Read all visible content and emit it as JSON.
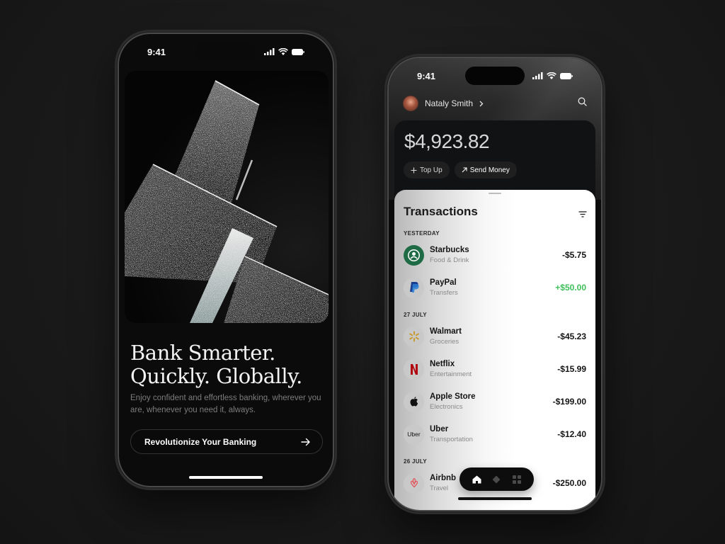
{
  "status_bar": {
    "time": "9:41"
  },
  "onboarding": {
    "title_lines": [
      "Bank Smarter.",
      "Quickly. Globally."
    ],
    "subtitle": "Enjoy confident and effortless banking, wherever you are, whenever you need it, always.",
    "cta_label": "Revolutionize Your Banking",
    "cta_icon": "arrow-right-icon"
  },
  "dashboard": {
    "user_name": "Nataly Smith",
    "balance": "$4,923.82",
    "actions": [
      {
        "label": "Top Up",
        "icon": "plus-icon"
      },
      {
        "label": "Send Money",
        "icon": "arrow-up-right-icon"
      }
    ],
    "transactions_title": "Transactions",
    "groups": [
      {
        "label": "YESTERDAY",
        "items": [
          {
            "name": "Starbucks",
            "category": "Food & Drink",
            "amount": "-$5.75",
            "positive": false,
            "logo": "starbucks"
          },
          {
            "name": "PayPal",
            "category": "Transfers",
            "amount": "+$50.00",
            "positive": true,
            "logo": "paypal"
          }
        ]
      },
      {
        "label": "27 JULY",
        "items": [
          {
            "name": "Walmart",
            "category": "Groceries",
            "amount": "-$45.23",
            "positive": false,
            "logo": "walmart"
          },
          {
            "name": "Netflix",
            "category": "Entertainment",
            "amount": "-$15.99",
            "positive": false,
            "logo": "netflix"
          },
          {
            "name": "Apple Store",
            "category": "Electronics",
            "amount": "-$199.00",
            "positive": false,
            "logo": "apple"
          },
          {
            "name": "Uber",
            "category": "Transportation",
            "amount": "-$12.40",
            "positive": false,
            "logo": "uber",
            "logo_text": "Uber"
          }
        ]
      },
      {
        "label": "26 JULY",
        "items": [
          {
            "name": "Airbnb",
            "category": "Travel",
            "amount": "-$250.00",
            "positive": false,
            "logo": "airbnb"
          }
        ]
      }
    ],
    "tab_bar": [
      {
        "name": "home",
        "active": true
      },
      {
        "name": "rewards",
        "active": false
      },
      {
        "name": "apps",
        "active": false
      }
    ],
    "colors": {
      "positive": "#3fbf5a",
      "netflix": "#b1060f",
      "walmart": "#c79a2e",
      "paypal": "#1b3f8f",
      "airbnb": "#e0565b",
      "starbucks": "#1e6b46"
    }
  }
}
